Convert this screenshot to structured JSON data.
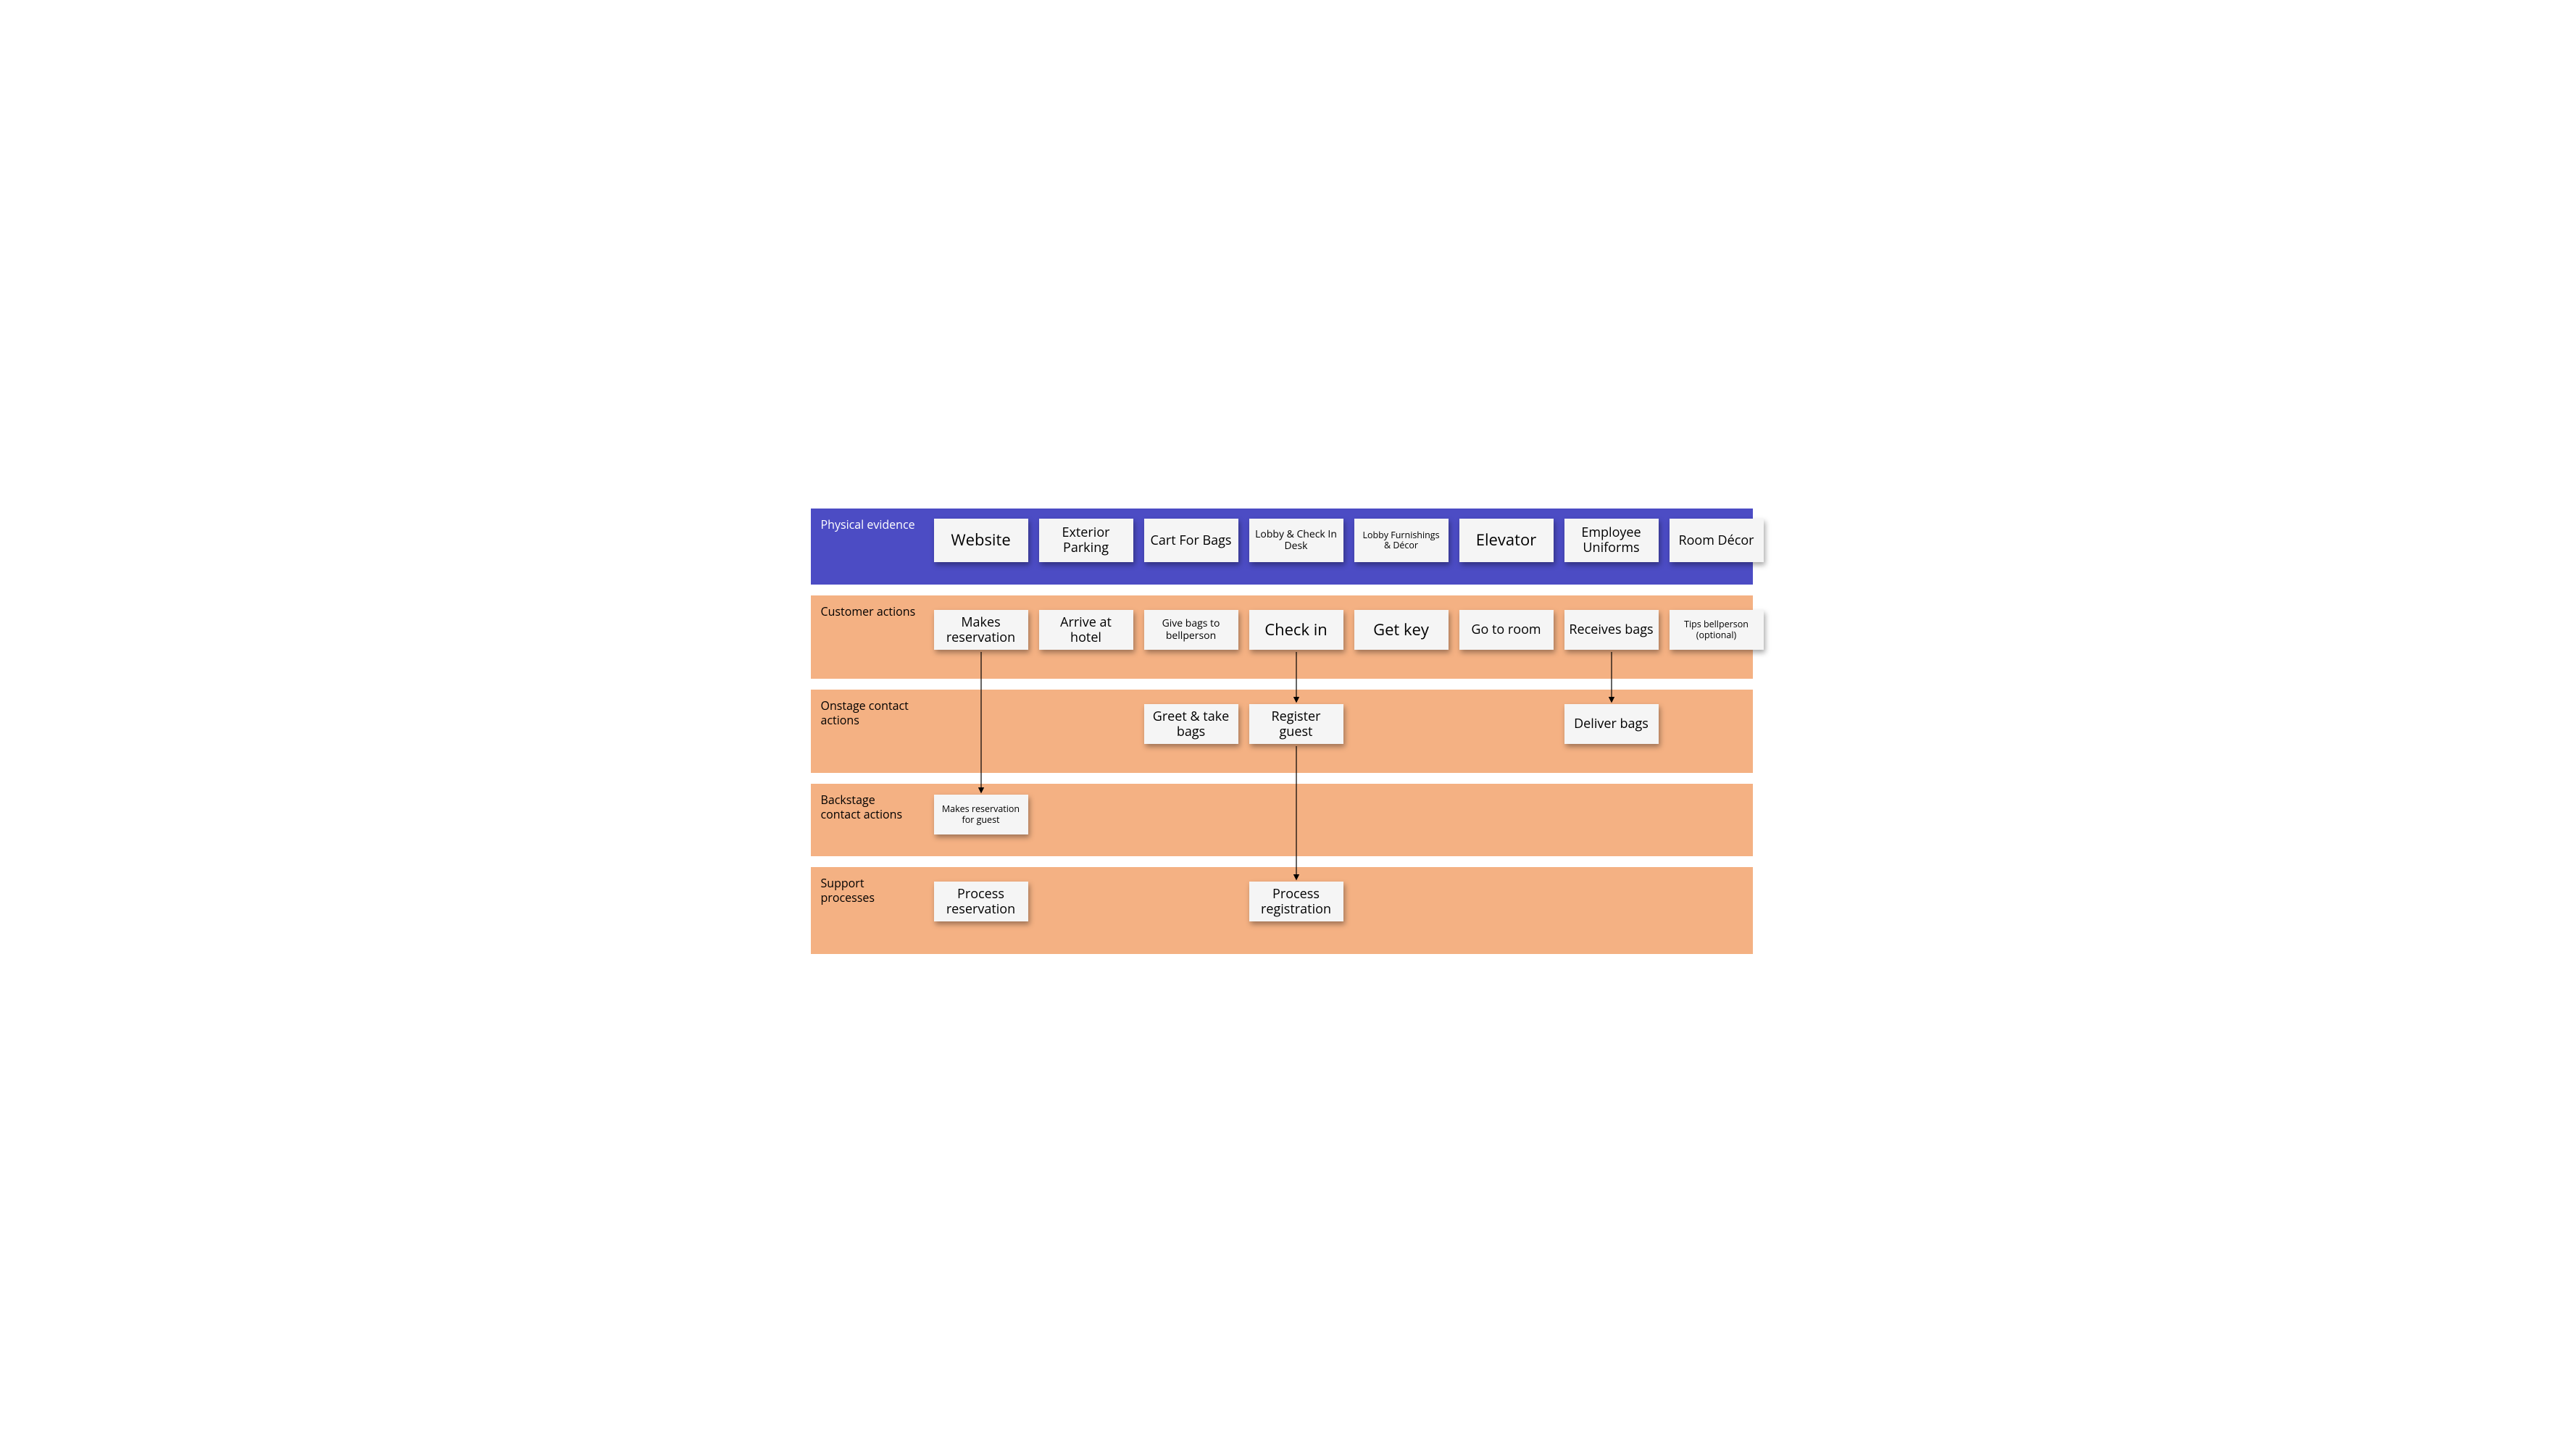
{
  "lanes": {
    "physical_evidence": {
      "label": "Physical evidence"
    },
    "customer_actions": {
      "label": "Customer actions"
    },
    "onstage": {
      "label": "Onstage contact actions"
    },
    "backstage": {
      "label": "Backstage contact actions"
    },
    "support": {
      "label": "Support processes"
    }
  },
  "notes": {
    "pe_website": "Website",
    "pe_parking": "Exterior Parking",
    "pe_cart": "Cart For Bags",
    "pe_lobby_desk": "Lobby & Check In Desk",
    "pe_lobby_furn": "Lobby Furnishings & Décor",
    "pe_elevator": "Elevator",
    "pe_uniforms": "Employee Uniforms",
    "pe_room": "Room Décor",
    "ca_reservation": "Makes reservation",
    "ca_arrive": "Arrive at hotel",
    "ca_give_bags": "Give bags to bellperson",
    "ca_checkin": "Check in",
    "ca_getkey": "Get key",
    "ca_go_room": "Go to room",
    "ca_receive_bags": "Receives bags",
    "ca_tips": "Tips bellperson (optional)",
    "on_greet": "Greet & take bags",
    "on_register": "Register guest",
    "on_deliver": "Deliver bags",
    "bs_reservation": "Makes reservation for guest",
    "sp_process_res": "Process reservation",
    "sp_process_reg": "Process registration"
  }
}
